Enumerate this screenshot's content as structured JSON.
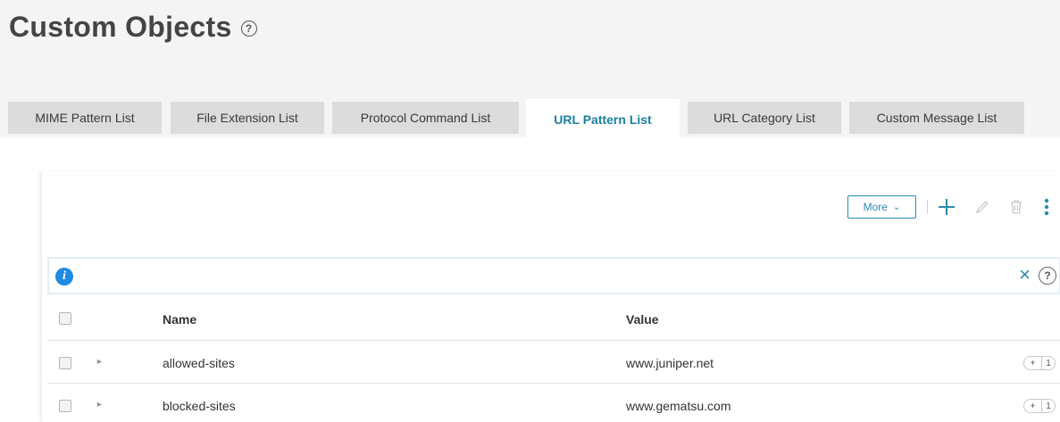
{
  "page": {
    "title": "Custom Objects",
    "help_glyph": "?"
  },
  "tabs": [
    {
      "label": "MIME Pattern List",
      "active": false
    },
    {
      "label": "File Extension List",
      "active": false
    },
    {
      "label": "Protocol Command List",
      "active": false
    },
    {
      "label": "URL Pattern List",
      "active": true
    },
    {
      "label": "URL Category List",
      "active": false
    },
    {
      "label": "Custom Message List",
      "active": false
    }
  ],
  "toolbar": {
    "more_label": "More",
    "icons": [
      "add-icon",
      "edit-icon",
      "delete-icon",
      "kebab-menu-icon"
    ]
  },
  "filter": {
    "info_glyph": "i",
    "clear_glyph": "×",
    "help_glyph": "?"
  },
  "table": {
    "columns": [
      "Name",
      "Value"
    ],
    "rows": [
      {
        "name": "allowed-sites",
        "value": "www.juniper.net",
        "count_plus": "+",
        "count": "1"
      },
      {
        "name": "blocked-sites",
        "value": "www.gematsu.com",
        "count_plus": "+",
        "count": "1"
      }
    ]
  },
  "colors": {
    "accent": "#2a8ab0",
    "active_tab_text": "#1a7fa0",
    "info_blue": "#1f8ae0"
  }
}
